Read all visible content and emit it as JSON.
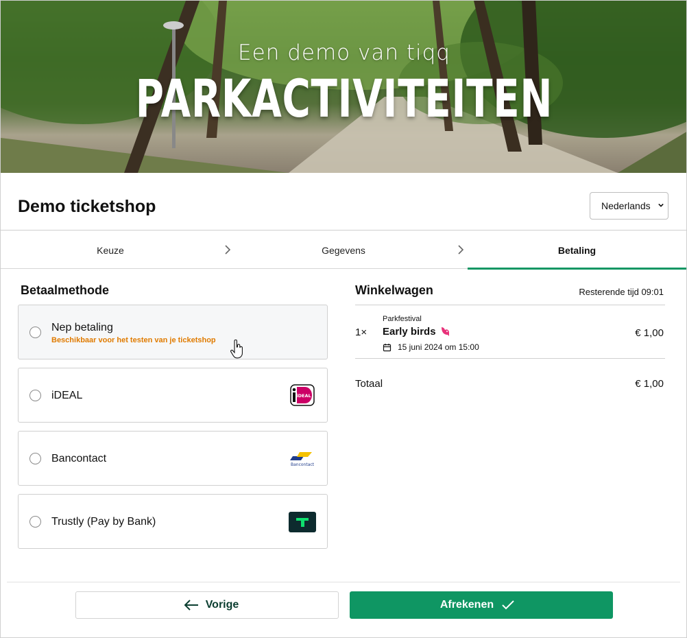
{
  "banner": {
    "subtitle": "Een demo van tiqq",
    "title": "PARKACTIVITEITEN"
  },
  "header": {
    "shop_title": "Demo ticketshop",
    "language": "Nederlands"
  },
  "steps": [
    {
      "label": "Keuze",
      "active": false
    },
    {
      "label": "Gegevens",
      "active": false
    },
    {
      "label": "Betaling",
      "active": true
    }
  ],
  "payment": {
    "heading": "Betaalmethode",
    "methods": [
      {
        "label": "Nep betaling",
        "hint": "Beschikbaar voor het testen van je ticketshop",
        "selected": false
      },
      {
        "label": "iDEAL",
        "logo": "ideal-logo",
        "logo_text": "iDEAL"
      },
      {
        "label": "Bancontact",
        "logo": "bancontact-logo",
        "logo_text": "Bancontact"
      },
      {
        "label": "Trustly (Pay by Bank)",
        "logo": "trustly-logo"
      }
    ]
  },
  "cart": {
    "heading": "Winkelwagen",
    "time_left": "Resterende tijd 09:01",
    "items": [
      {
        "qty": "1×",
        "event": "Parkfestival",
        "name": "Early birds",
        "icon": "bird-icon",
        "date": "15 juni 2024 om 15:00",
        "price": "€ 1,00"
      }
    ],
    "total_label": "Totaal",
    "total_value": "€ 1,00"
  },
  "footer": {
    "prev_label": "Vorige",
    "next_label": "Afrekenen"
  },
  "colors": {
    "accent": "#0f9663",
    "hint": "#e07b00",
    "ideal": "#cc0066"
  }
}
